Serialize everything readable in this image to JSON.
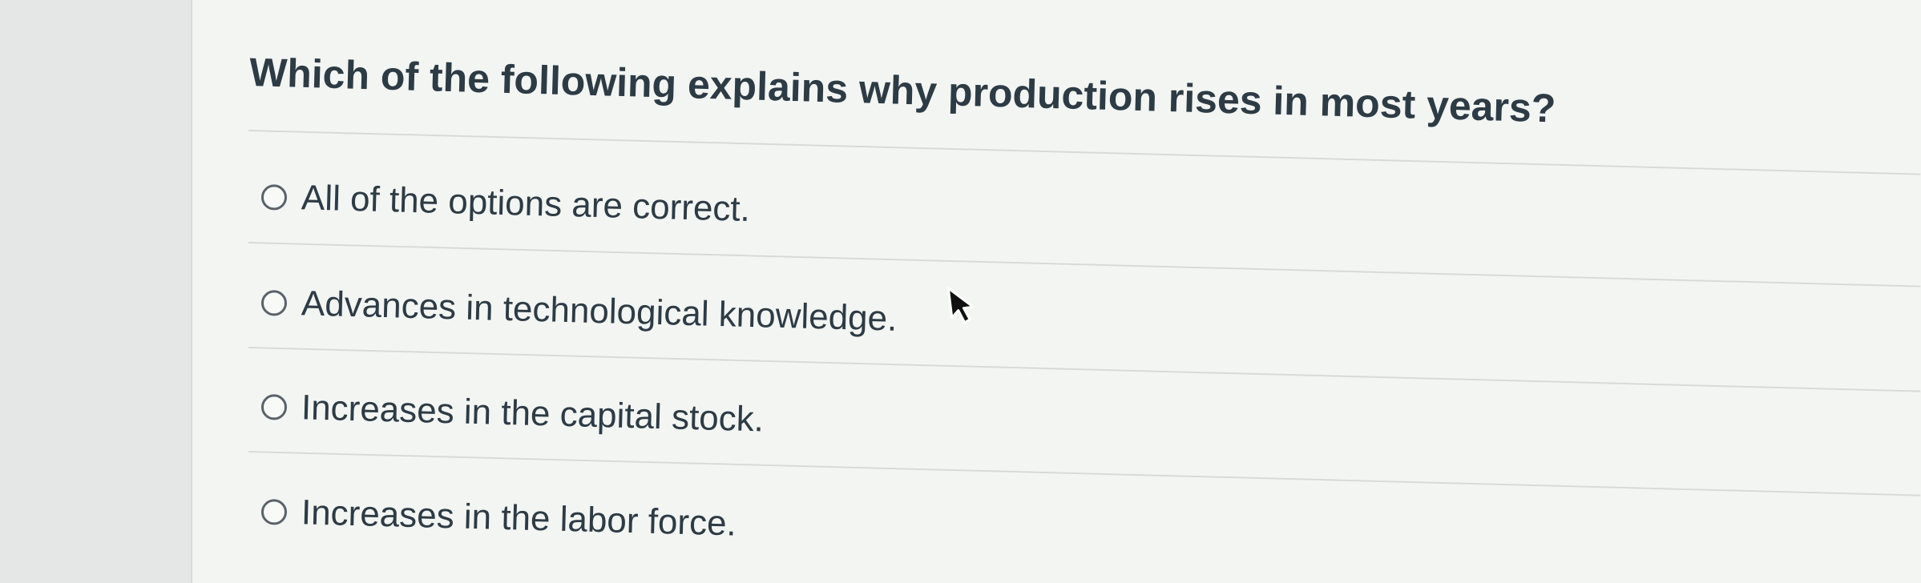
{
  "question": {
    "text": "Which of the following explains why production rises in most years?"
  },
  "answers": [
    {
      "label": "All of the options are correct.",
      "selected": false
    },
    {
      "label": "Advances in technological knowledge.",
      "selected": false
    },
    {
      "label": "Increases in the capital stock.",
      "selected": false
    },
    {
      "label": "Increases in the labor force.",
      "selected": false
    }
  ],
  "icons": {
    "radio": "radio-button-icon",
    "pointer": "mouse-pointer-icon"
  },
  "colors": {
    "text": "#2d3b45",
    "radio_border": "#59626a",
    "background": "#f3f5f3"
  }
}
